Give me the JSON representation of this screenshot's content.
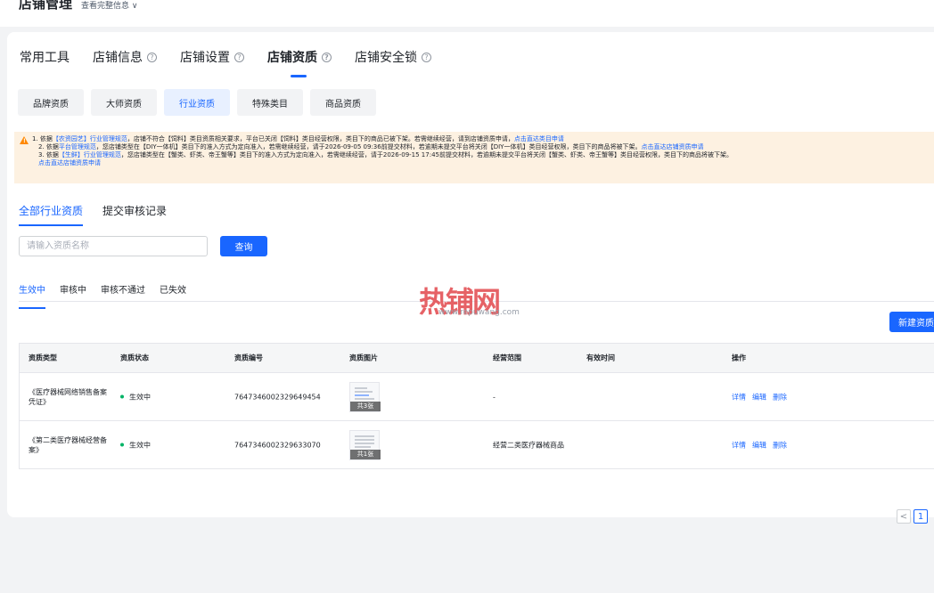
{
  "header": {
    "title": "店铺管理",
    "sub_link": "查看完整信息 ∨"
  },
  "main_tabs": [
    {
      "label": "常用工具",
      "help": false
    },
    {
      "label": "店铺信息",
      "help": true
    },
    {
      "label": "店铺设置",
      "help": true
    },
    {
      "label": "店铺资质",
      "help": true,
      "active": true
    },
    {
      "label": "店铺安全锁",
      "help": true
    }
  ],
  "sub_tabs": [
    "品牌资质",
    "大师资质",
    "行业资质",
    "特殊类目",
    "商品资质"
  ],
  "sub_tab_active": "行业资质",
  "notice": {
    "line1": {
      "pre": "1. 依据",
      "link1": "【农资园艺】行业管理规范",
      "mid": "，店铺不符合【饲料】类目资质相关要求，平台已关闭【饲料】类目经营权限，类目下的商品已被下架。若需继续经营，请到店铺资质申请，",
      "link2": "点击直达类目申请"
    },
    "line2": {
      "pre": "2. 依据",
      "link1": "平台管理规范",
      "mid": "，您店铺类型在【DIY一体机】类目下的准入方式为定向准入，若需继续经营，请于2026-09-05 09:36前提交材料，若逾期未提交平台将关闭【DIY一体机】类目经营权限，类目下的商品将被下架。",
      "link2": "点击直达店铺资质申请"
    },
    "line3": {
      "pre": "3. 依据",
      "link1": "【生鲜】行业管理规范",
      "mid": "，您店铺类型在【蟹类、虾类、帝王蟹等】类目下的准入方式为定向准入，若需继续经营，请于2026-09-15 17:45前提交材料，若逾期未提交平台将关闭【蟹类、虾类、帝王蟹等】类目经营权限，类目下的商品将被下架。"
    },
    "line4": {
      "link": "点击直达店铺资质申请"
    }
  },
  "list_tabs": [
    "全部行业资质",
    "提交审核记录"
  ],
  "search": {
    "placeholder": "请输入资质名称",
    "button": "查询"
  },
  "status_tabs": [
    "生效中",
    "审核中",
    "审核不通过",
    "已失效"
  ],
  "watermark": {
    "text": "热铺网",
    "url": "www.repuwang.com"
  },
  "new_button": "新建资质",
  "table": {
    "headers": [
      "资质类型",
      "资质状态",
      "资质编号",
      "资质图片",
      "经营范围",
      "有效时间",
      "操作"
    ],
    "rows": [
      {
        "type": "《医疗器械网络销售备案凭证》",
        "status": "生效中",
        "number": "7647346002329649454",
        "img_count": "共3张",
        "scope": "-",
        "valid": "",
        "ops": [
          "详情",
          "编辑",
          "删除"
        ]
      },
      {
        "type": "《第二类医疗器械经营备案》",
        "status": "生效中",
        "number": "7647346002329633070",
        "img_count": "共1张",
        "scope": "经营二类医疗器械商品",
        "valid": "",
        "ops": [
          "详情",
          "编辑",
          "删除"
        ]
      }
    ]
  },
  "pagination": {
    "prev": "<",
    "current": "1"
  },
  "colors": {
    "primary": "#1966ff",
    "notice_bg": "#fdf1e1",
    "success": "#00b365"
  }
}
